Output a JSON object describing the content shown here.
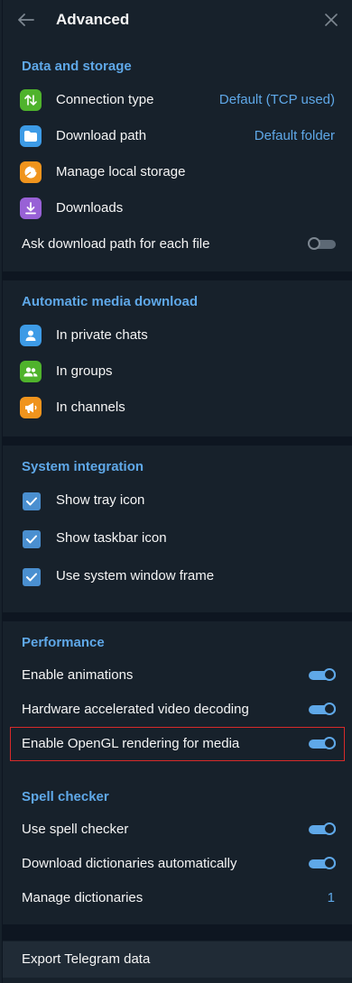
{
  "header": {
    "title": "Advanced"
  },
  "data_storage": {
    "title": "Data and storage",
    "connection_type": {
      "label": "Connection type",
      "value": "Default (TCP used)"
    },
    "download_path": {
      "label": "Download path",
      "value": "Default folder"
    },
    "manage_storage": {
      "label": "Manage local storage"
    },
    "downloads": {
      "label": "Downloads"
    },
    "ask_path": {
      "label": "Ask download path for each file",
      "enabled": false
    }
  },
  "auto_media": {
    "title": "Automatic media download",
    "private_chats": "In private chats",
    "groups": "In groups",
    "channels": "In channels"
  },
  "system_integration": {
    "title": "System integration",
    "tray_icon": {
      "label": "Show tray icon",
      "checked": true
    },
    "taskbar_icon": {
      "label": "Show taskbar icon",
      "checked": true
    },
    "window_frame": {
      "label": "Use system window frame",
      "checked": true
    }
  },
  "performance": {
    "title": "Performance",
    "animations": {
      "label": "Enable animations",
      "enabled": true
    },
    "hw_video": {
      "label": "Hardware accelerated video decoding",
      "enabled": true
    },
    "opengl": {
      "label": "Enable OpenGL rendering for media",
      "enabled": true
    }
  },
  "spell_checker": {
    "title": "Spell checker",
    "use": {
      "label": "Use spell checker",
      "enabled": true
    },
    "download_dicts": {
      "label": "Download dictionaries automatically",
      "enabled": true
    },
    "manage_dicts": {
      "label": "Manage dictionaries",
      "value": "1"
    }
  },
  "export": {
    "label": "Export Telegram data"
  },
  "colors": {
    "background": "#17212b",
    "accent": "#5fa8e8",
    "highlight_border": "#d72a2a"
  }
}
